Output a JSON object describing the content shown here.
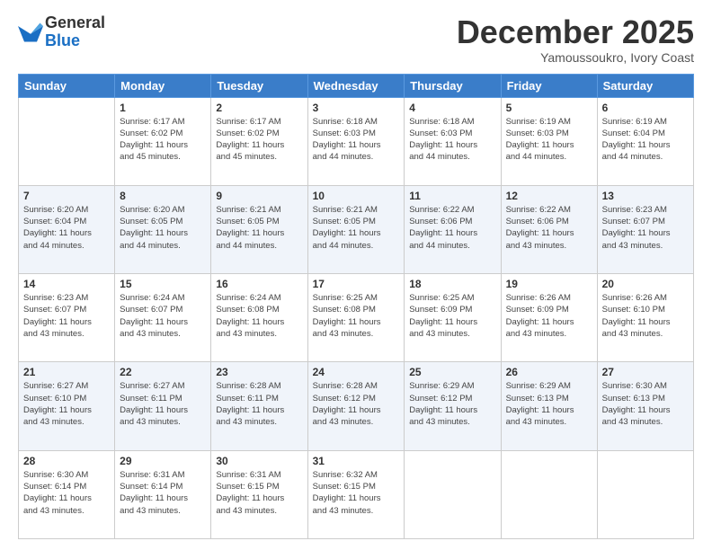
{
  "logo": {
    "general": "General",
    "blue": "Blue"
  },
  "title": "December 2025",
  "subtitle": "Yamoussoukro, Ivory Coast",
  "days_of_week": [
    "Sunday",
    "Monday",
    "Tuesday",
    "Wednesday",
    "Thursday",
    "Friday",
    "Saturday"
  ],
  "weeks": [
    [
      {
        "day": "",
        "sunrise": "",
        "sunset": "",
        "daylight": ""
      },
      {
        "day": "1",
        "sunrise": "Sunrise: 6:17 AM",
        "sunset": "Sunset: 6:02 PM",
        "daylight": "Daylight: 11 hours and 45 minutes."
      },
      {
        "day": "2",
        "sunrise": "Sunrise: 6:17 AM",
        "sunset": "Sunset: 6:02 PM",
        "daylight": "Daylight: 11 hours and 45 minutes."
      },
      {
        "day": "3",
        "sunrise": "Sunrise: 6:18 AM",
        "sunset": "Sunset: 6:03 PM",
        "daylight": "Daylight: 11 hours and 44 minutes."
      },
      {
        "day": "4",
        "sunrise": "Sunrise: 6:18 AM",
        "sunset": "Sunset: 6:03 PM",
        "daylight": "Daylight: 11 hours and 44 minutes."
      },
      {
        "day": "5",
        "sunrise": "Sunrise: 6:19 AM",
        "sunset": "Sunset: 6:03 PM",
        "daylight": "Daylight: 11 hours and 44 minutes."
      },
      {
        "day": "6",
        "sunrise": "Sunrise: 6:19 AM",
        "sunset": "Sunset: 6:04 PM",
        "daylight": "Daylight: 11 hours and 44 minutes."
      }
    ],
    [
      {
        "day": "7",
        "sunrise": "Sunrise: 6:20 AM",
        "sunset": "Sunset: 6:04 PM",
        "daylight": "Daylight: 11 hours and 44 minutes."
      },
      {
        "day": "8",
        "sunrise": "Sunrise: 6:20 AM",
        "sunset": "Sunset: 6:05 PM",
        "daylight": "Daylight: 11 hours and 44 minutes."
      },
      {
        "day": "9",
        "sunrise": "Sunrise: 6:21 AM",
        "sunset": "Sunset: 6:05 PM",
        "daylight": "Daylight: 11 hours and 44 minutes."
      },
      {
        "day": "10",
        "sunrise": "Sunrise: 6:21 AM",
        "sunset": "Sunset: 6:05 PM",
        "daylight": "Daylight: 11 hours and 44 minutes."
      },
      {
        "day": "11",
        "sunrise": "Sunrise: 6:22 AM",
        "sunset": "Sunset: 6:06 PM",
        "daylight": "Daylight: 11 hours and 44 minutes."
      },
      {
        "day": "12",
        "sunrise": "Sunrise: 6:22 AM",
        "sunset": "Sunset: 6:06 PM",
        "daylight": "Daylight: 11 hours and 43 minutes."
      },
      {
        "day": "13",
        "sunrise": "Sunrise: 6:23 AM",
        "sunset": "Sunset: 6:07 PM",
        "daylight": "Daylight: 11 hours and 43 minutes."
      }
    ],
    [
      {
        "day": "14",
        "sunrise": "Sunrise: 6:23 AM",
        "sunset": "Sunset: 6:07 PM",
        "daylight": "Daylight: 11 hours and 43 minutes."
      },
      {
        "day": "15",
        "sunrise": "Sunrise: 6:24 AM",
        "sunset": "Sunset: 6:07 PM",
        "daylight": "Daylight: 11 hours and 43 minutes."
      },
      {
        "day": "16",
        "sunrise": "Sunrise: 6:24 AM",
        "sunset": "Sunset: 6:08 PM",
        "daylight": "Daylight: 11 hours and 43 minutes."
      },
      {
        "day": "17",
        "sunrise": "Sunrise: 6:25 AM",
        "sunset": "Sunset: 6:08 PM",
        "daylight": "Daylight: 11 hours and 43 minutes."
      },
      {
        "day": "18",
        "sunrise": "Sunrise: 6:25 AM",
        "sunset": "Sunset: 6:09 PM",
        "daylight": "Daylight: 11 hours and 43 minutes."
      },
      {
        "day": "19",
        "sunrise": "Sunrise: 6:26 AM",
        "sunset": "Sunset: 6:09 PM",
        "daylight": "Daylight: 11 hours and 43 minutes."
      },
      {
        "day": "20",
        "sunrise": "Sunrise: 6:26 AM",
        "sunset": "Sunset: 6:10 PM",
        "daylight": "Daylight: 11 hours and 43 minutes."
      }
    ],
    [
      {
        "day": "21",
        "sunrise": "Sunrise: 6:27 AM",
        "sunset": "Sunset: 6:10 PM",
        "daylight": "Daylight: 11 hours and 43 minutes."
      },
      {
        "day": "22",
        "sunrise": "Sunrise: 6:27 AM",
        "sunset": "Sunset: 6:11 PM",
        "daylight": "Daylight: 11 hours and 43 minutes."
      },
      {
        "day": "23",
        "sunrise": "Sunrise: 6:28 AM",
        "sunset": "Sunset: 6:11 PM",
        "daylight": "Daylight: 11 hours and 43 minutes."
      },
      {
        "day": "24",
        "sunrise": "Sunrise: 6:28 AM",
        "sunset": "Sunset: 6:12 PM",
        "daylight": "Daylight: 11 hours and 43 minutes."
      },
      {
        "day": "25",
        "sunrise": "Sunrise: 6:29 AM",
        "sunset": "Sunset: 6:12 PM",
        "daylight": "Daylight: 11 hours and 43 minutes."
      },
      {
        "day": "26",
        "sunrise": "Sunrise: 6:29 AM",
        "sunset": "Sunset: 6:13 PM",
        "daylight": "Daylight: 11 hours and 43 minutes."
      },
      {
        "day": "27",
        "sunrise": "Sunrise: 6:30 AM",
        "sunset": "Sunset: 6:13 PM",
        "daylight": "Daylight: 11 hours and 43 minutes."
      }
    ],
    [
      {
        "day": "28",
        "sunrise": "Sunrise: 6:30 AM",
        "sunset": "Sunset: 6:14 PM",
        "daylight": "Daylight: 11 hours and 43 minutes."
      },
      {
        "day": "29",
        "sunrise": "Sunrise: 6:31 AM",
        "sunset": "Sunset: 6:14 PM",
        "daylight": "Daylight: 11 hours and 43 minutes."
      },
      {
        "day": "30",
        "sunrise": "Sunrise: 6:31 AM",
        "sunset": "Sunset: 6:15 PM",
        "daylight": "Daylight: 11 hours and 43 minutes."
      },
      {
        "day": "31",
        "sunrise": "Sunrise: 6:32 AM",
        "sunset": "Sunset: 6:15 PM",
        "daylight": "Daylight: 11 hours and 43 minutes."
      },
      {
        "day": "",
        "sunrise": "",
        "sunset": "",
        "daylight": ""
      },
      {
        "day": "",
        "sunrise": "",
        "sunset": "",
        "daylight": ""
      },
      {
        "day": "",
        "sunrise": "",
        "sunset": "",
        "daylight": ""
      }
    ]
  ]
}
